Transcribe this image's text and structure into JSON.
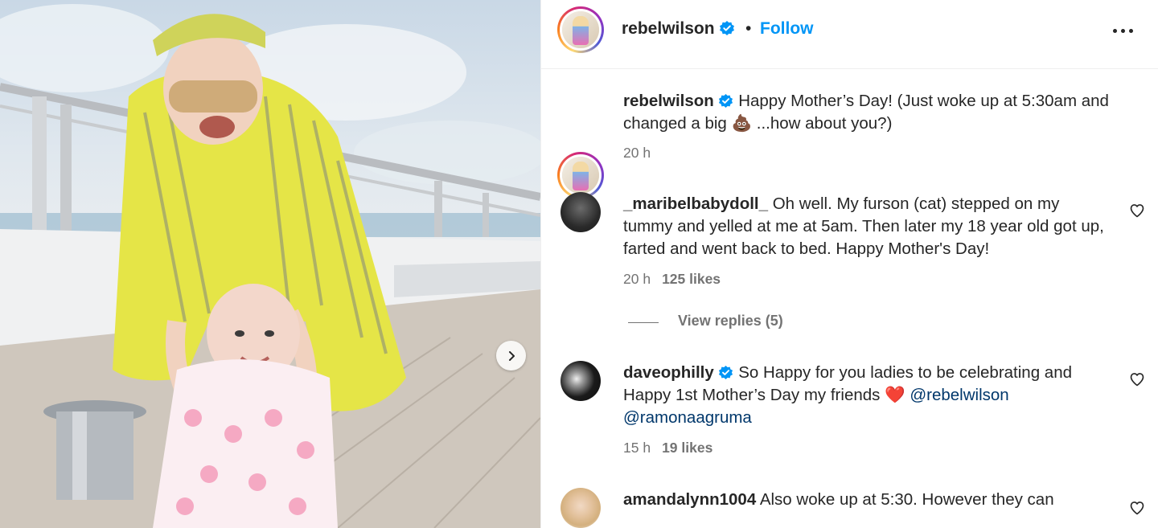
{
  "post": {
    "username": "rebelwilson",
    "follow_label": "Follow",
    "separator": "•"
  },
  "caption": {
    "username": "rebelwilson",
    "text_before_emoji": "Happy Mother’s Day! (Just woke up at 5:30am and changed a big",
    "emoji": "💩",
    "text_after_emoji": " ...how about you?)",
    "time": "20 h"
  },
  "comments": [
    {
      "username": "_maribelbabydoll_",
      "text": "Oh well. My furson (cat) stepped on my tummy and yelled at me at 5am. Then later my 18 year old got up, farted and went back to bed. Happy Mother's Day!",
      "time": "20 h",
      "likes": "125 likes",
      "view_replies": "View replies (5)"
    },
    {
      "username": "daveophilly",
      "text": "So Happy for you ladies to be celebrating and Happy 1st Mother’s Day my friends",
      "emoji": "❤️",
      "mention1": "@rebelwilson",
      "mention2": "@ramonaagruma",
      "time": "15 h",
      "likes": "19 likes"
    },
    {
      "username": "amandalynn1004",
      "text": "Also woke up at 5:30. However they can"
    }
  ],
  "icons": {
    "verified": "verified-badge-icon",
    "more": "more-options-icon",
    "heart": "heart-outline-icon",
    "next": "chevron-right-icon"
  },
  "colors": {
    "accent": "#0095f6",
    "verified": "#0095f6",
    "text": "#262626",
    "secondary": "#737373",
    "mention": "#00376b"
  }
}
